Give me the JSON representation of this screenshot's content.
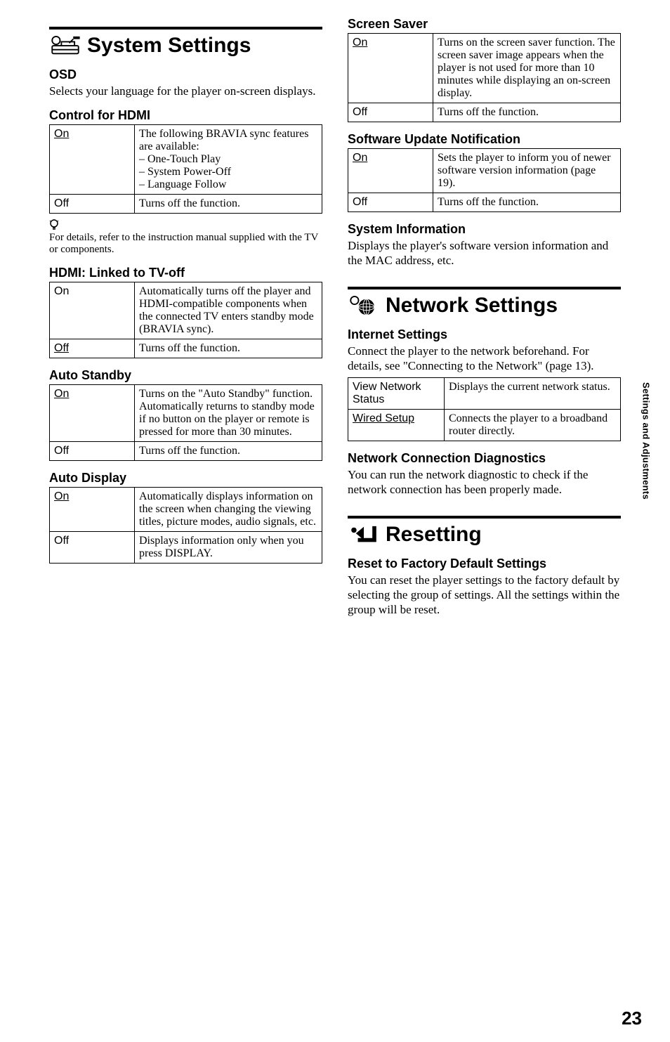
{
  "page_number": "23",
  "side_tab": "Settings and Adjustments",
  "left": {
    "section_title": "System Settings",
    "icon_name": "toolbox-icon",
    "osd": {
      "heading": "OSD",
      "body": "Selects your language for the player on-screen displays."
    },
    "control_hdmi": {
      "heading": "Control for HDMI",
      "on_label": "On",
      "on_desc": "The following BRAVIA sync features are available:\n– One-Touch Play\n– System Power-Off\n– Language Follow",
      "off_label": "Off",
      "off_desc": "Turns off the function."
    },
    "tip": "For details, refer to the instruction manual supplied with the TV or components.",
    "linked": {
      "heading": "HDMI: Linked to TV-off",
      "on_label": "On",
      "on_desc": "Automatically turns off the player and HDMI-compatible components when the connected TV enters standby mode (BRAVIA sync).",
      "off_label": "Off",
      "off_desc": "Turns off the function."
    },
    "auto_standby": {
      "heading": "Auto Standby",
      "on_label": "On",
      "on_desc": "Turns on the \"Auto Standby\" function. Automatically returns to standby mode if no button on the player or remote is pressed for more than 30 minutes.",
      "off_label": "Off",
      "off_desc": "Turns off the function."
    },
    "auto_display": {
      "heading": "Auto Display",
      "on_label": "On",
      "on_desc": "Automatically displays information on the screen when changing the viewing titles, picture modes, audio signals, etc.",
      "off_label": "Off",
      "off_desc": "Displays information only when you press DISPLAY."
    }
  },
  "right": {
    "screen_saver": {
      "heading": "Screen Saver",
      "on_label": "On",
      "on_desc": "Turns on the screen saver function. The screen saver image appears when the player is not used for more than 10 minutes while displaying an on-screen display.",
      "off_label": "Off",
      "off_desc": "Turns off the function."
    },
    "software_update": {
      "heading": "Software Update Notification",
      "on_label": "On",
      "on_desc": "Sets the player to inform you of newer software version information (page 19).",
      "off_label": "Off",
      "off_desc": "Turns off the function."
    },
    "system_info": {
      "heading": "System Information",
      "body": "Displays the player's software version information and the MAC address, etc."
    },
    "network": {
      "section_title": "Network Settings",
      "icon_name": "globe-icon",
      "internet": {
        "heading": "Internet Settings",
        "body": "Connect the player to the network beforehand. For details, see \"Connecting to the Network\" (page 13).",
        "row1_label": "View Network Status",
        "row1_desc": "Displays the current network status.",
        "row2_label": "Wired Setup",
        "row2_desc": "Connects the player to a broadband router directly."
      },
      "diag": {
        "heading": "Network Connection Diagnostics",
        "body": "You can run the network diagnostic to check if the network connection has been properly made."
      }
    },
    "resetting": {
      "section_title": "Resetting",
      "icon_name": "reset-arrow-icon",
      "reset": {
        "heading": "Reset to Factory Default Settings",
        "body": "You can reset the player settings to the factory default by selecting the group of settings. All the settings within the group will be reset."
      }
    }
  }
}
